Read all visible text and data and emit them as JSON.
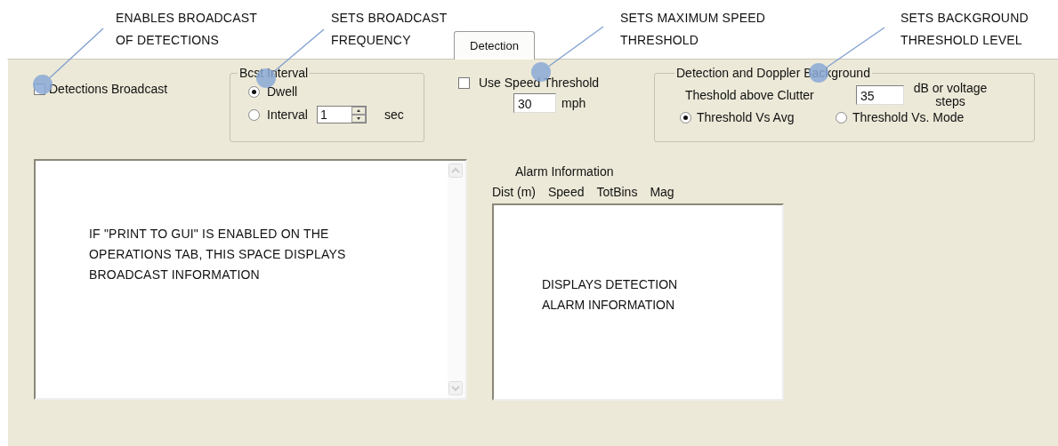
{
  "annotations": [
    {
      "text": "ENABLES BROADCAST OF DETECTIONS"
    },
    {
      "text": "SETS BROADCAST FREQUENCY"
    },
    {
      "text": "SETS MAXIMUM SPEED THRESHOLD"
    },
    {
      "text": "SETS BACKGROUND THRESHOLD LEVEL"
    }
  ],
  "tab": {
    "label": "Detection",
    "selected": true
  },
  "broadcast_checkbox": {
    "label": "Detections Broadcast",
    "checked": false
  },
  "bcst_interval": {
    "title": "Bcst Interval",
    "options": [
      {
        "label": "Dwell",
        "selected": true
      },
      {
        "label": "Interval",
        "selected": false
      }
    ],
    "interval_value": "1",
    "unit": "sec"
  },
  "speed": {
    "label": "Use Speed Threshold",
    "checked": false,
    "value": "30",
    "unit": "mph"
  },
  "background": {
    "title": "Detection and Doppler Background",
    "threshold_label": "Theshold above Clutter",
    "threshold_value": "35",
    "unit": "dB or voltage steps",
    "options": [
      {
        "label": "Threshold Vs Avg",
        "selected": true
      },
      {
        "label": "Threshold Vs. Mode",
        "selected": false
      }
    ]
  },
  "broadcast_output": {
    "text": "IF \"PRINT TO GUI\" IS ENABLED ON THE OPERATIONS TAB, THIS SPACE DISPLAYS BROADCAST INFORMATION"
  },
  "alarm": {
    "title": "Alarm Information",
    "columns": [
      "Dist (m)",
      "Speed",
      "TotBins",
      "Mag"
    ],
    "text": "DISPLAYS DETECTION ALARM INFORMATION"
  }
}
